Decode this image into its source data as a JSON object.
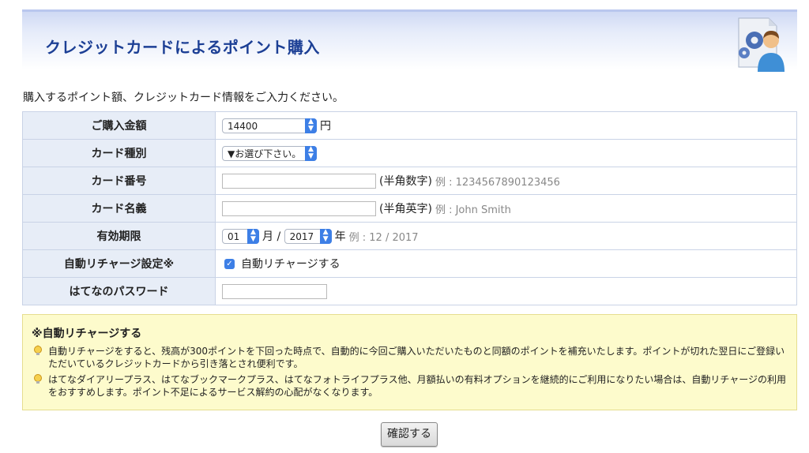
{
  "header": {
    "title": "クレジットカードによるポイント購入"
  },
  "intro": "購入するポイント額、クレジットカード情報をご入力ください。",
  "form": {
    "amount": {
      "label": "ご購入金額",
      "value": "14400",
      "unit": "円"
    },
    "card_type": {
      "label": "カード種別",
      "value": "▼お選び下さい。"
    },
    "card_number": {
      "label": "カード番号",
      "value": "",
      "note": "(半角数字)",
      "example": "例 : 1234567890123456"
    },
    "card_name": {
      "label": "カード名義",
      "value": "",
      "note": "(半角英字)",
      "example": "例 : John Smith"
    },
    "expiry": {
      "label": "有効期限",
      "month": "01",
      "month_unit": "月 /",
      "year": "2017",
      "year_unit": "年",
      "example": "例 : 12 / 2017"
    },
    "auto_recharge": {
      "label": "自動リチャージ設定※",
      "checked": true,
      "checkbox_label": "自動リチャージする"
    },
    "password": {
      "label": "はてなのパスワード",
      "value": ""
    }
  },
  "notice": {
    "title": "※自動リチャージする",
    "items": [
      "自動リチャージをすると、残高が300ポイントを下回った時点で、自動的に今回ご購入いただいたものと同額のポイントを補充いたします。ポイントが切れた翌日にご登録いただいているクレジットカードから引き落とされ便利です。",
      "はてなダイアリープラス、はてなブックマークプラス、はてなフォトライフプラス他、月額払いの有料オプションを継続的にご利用になりたい場合は、自動リチャージの利用をおすすめします。ポイント不足によるサービス解約の心配がなくなります。"
    ]
  },
  "confirm_button": "確認する"
}
